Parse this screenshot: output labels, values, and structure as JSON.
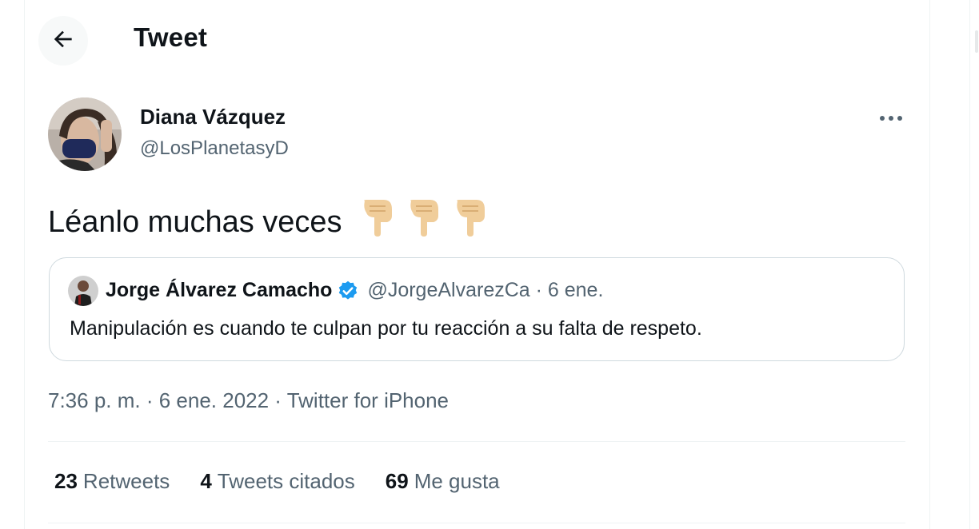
{
  "header": {
    "title": "Tweet"
  },
  "tweet": {
    "author_name": "Diana Vázquez",
    "author_handle": "@LosPlanetasyD",
    "text": "Léanlo muchas veces",
    "emojis": [
      "pointing-down-hand",
      "pointing-down-hand",
      "pointing-down-hand"
    ],
    "timestamp": "7:36 p. m. · 6 ene. 2022 · Twitter for iPhone"
  },
  "quoted_tweet": {
    "author_name": "Jorge Álvarez Camacho",
    "verified": true,
    "meta": "@JorgeAlvarezCa · 6 ene.",
    "text": "Manipulación es cuando te culpan por tu reacción a su falta de respeto."
  },
  "stats": [
    {
      "count": "23",
      "label": "Retweets"
    },
    {
      "count": "4",
      "label": "Tweets citados"
    },
    {
      "count": "69",
      "label": "Me gusta"
    }
  ],
  "colors": {
    "text_primary": "#0f1419",
    "text_secondary": "#536471",
    "border": "#cfd9de",
    "divider": "#eff3f4",
    "verified_blue": "#1d9bf0",
    "emoji_skin": "#f0cd9a"
  }
}
